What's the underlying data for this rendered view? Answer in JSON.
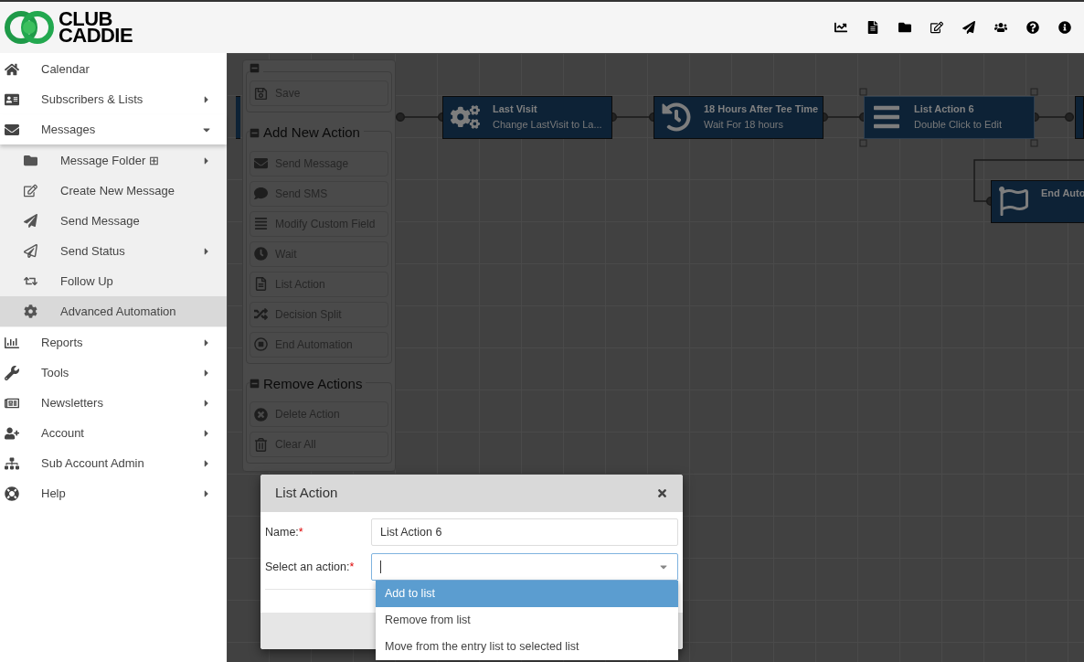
{
  "logo": {
    "line1": "CLUB",
    "line2": "CADDIE"
  },
  "sidebar": {
    "items": [
      {
        "label": "Calendar",
        "has_submenu": false
      },
      {
        "label": "Subscribers & Lists",
        "has_submenu": true,
        "expanded": false
      },
      {
        "label": "Messages",
        "has_submenu": true,
        "expanded": true,
        "children": [
          {
            "label": "Message Folder",
            "suffix": "⊞",
            "has_submenu": true,
            "selected": false
          },
          {
            "label": "Create New Message",
            "has_submenu": false,
            "selected": false
          },
          {
            "label": "Send Message",
            "has_submenu": false,
            "selected": false
          },
          {
            "label": "Send Status",
            "has_submenu": true,
            "selected": false
          },
          {
            "label": "Follow Up",
            "has_submenu": false,
            "selected": false
          },
          {
            "label": "Advanced Automation",
            "has_submenu": false,
            "selected": true
          }
        ]
      },
      {
        "label": "Reports",
        "has_submenu": true,
        "expanded": false
      },
      {
        "label": "Tools",
        "has_submenu": true,
        "expanded": false
      },
      {
        "label": "Newsletters",
        "has_submenu": true,
        "expanded": false
      },
      {
        "label": "Account",
        "has_submenu": true,
        "expanded": false
      },
      {
        "label": "Sub Account Admin",
        "has_submenu": true,
        "expanded": false
      },
      {
        "label": "Help",
        "has_submenu": true,
        "expanded": false
      }
    ]
  },
  "toolbox": {
    "sections": [
      {
        "items": [
          "Save"
        ]
      },
      {
        "title": "Add New Action",
        "items": [
          "Send Message",
          "Send SMS",
          "Modify Custom Field",
          "Wait",
          "List Action",
          "Decision Split",
          "End Automation"
        ]
      },
      {
        "title": "Remove Actions",
        "items": [
          "Delete Action",
          "Clear All"
        ]
      }
    ]
  },
  "canvas": {
    "nodes": [
      {
        "title": "Last Visit",
        "subtitle": "Change LastVisit to La...",
        "selected": false
      },
      {
        "title": "18 Hours After Tee Time",
        "subtitle": "Wait For 18 hours",
        "selected": false
      },
      {
        "title": "List Action 6",
        "subtitle": "Double Click to Edit",
        "selected": true
      },
      {
        "title": "End Auto",
        "selected": false
      }
    ]
  },
  "modal": {
    "title": "List Action",
    "fields": [
      {
        "kind": "text",
        "label": "Name:",
        "required": true,
        "required_mark": "*",
        "value": "List Action 6"
      },
      {
        "kind": "select",
        "label": "Select an action:",
        "required": true,
        "required_mark": "*",
        "open": true,
        "options": [
          {
            "label": "Add to list",
            "selected": true
          },
          {
            "label": "Remove from list",
            "selected": false
          },
          {
            "label": "Move from the entry list to selected list",
            "selected": false
          }
        ]
      }
    ]
  }
}
